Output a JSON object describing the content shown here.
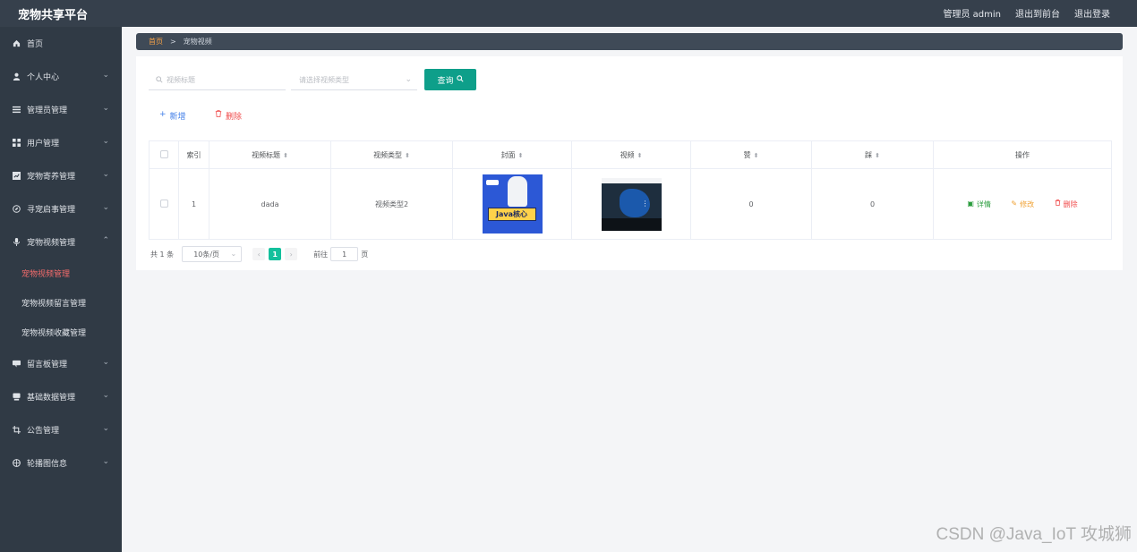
{
  "app": {
    "title": "宠物共享平台"
  },
  "header": {
    "user_label": "管理员 admin",
    "to_front": "退出到前台",
    "logout": "退出登录"
  },
  "sidebar": {
    "items": [
      {
        "label": "首页",
        "icon": "home-icon"
      },
      {
        "label": "个人中心",
        "icon": "user-icon"
      },
      {
        "label": "管理员管理",
        "icon": "menu-icon"
      },
      {
        "label": "用户管理",
        "icon": "grid-icon"
      },
      {
        "label": "宠物寄养管理",
        "icon": "chart-icon"
      },
      {
        "label": "寻宠启事管理",
        "icon": "compass-icon"
      },
      {
        "label": "宠物视频管理",
        "icon": "mic-icon"
      },
      {
        "label": "留言板管理",
        "icon": "comment-icon"
      },
      {
        "label": "基础数据管理",
        "icon": "database-icon"
      },
      {
        "label": "公告管理",
        "icon": "crop-icon"
      },
      {
        "label": "轮播图信息",
        "icon": "globe-icon"
      }
    ],
    "subitems": [
      {
        "label": "宠物视频管理"
      },
      {
        "label": "宠物视频留言管理"
      },
      {
        "label": "宠物视频收藏管理"
      }
    ]
  },
  "breadcrumb": {
    "home": "首页",
    "sep": ">",
    "current": "宠物视频"
  },
  "search": {
    "title_placeholder": "视频标题",
    "type_placeholder": "请选择视频类型",
    "query_label": "查询"
  },
  "actions": {
    "add_label": "新增",
    "delete_label": "删除"
  },
  "table": {
    "columns": [
      "索引",
      "视频标题",
      "视频类型",
      "封面",
      "视频",
      "赞",
      "踩",
      "操作"
    ],
    "rows": [
      {
        "index": "1",
        "title": "dada",
        "type": "视频类型2",
        "cover_text": "Java核心",
        "likes": "0",
        "dislikes": "0"
      }
    ],
    "ops": {
      "detail": "详情",
      "edit": "修改",
      "delete": "删除"
    }
  },
  "pagination": {
    "total": "共 1 条",
    "page_size": "10条/页",
    "current": "1",
    "jump_label": "前往",
    "jump_value": "1",
    "page_suffix": "页"
  },
  "watermark": "CSDN @Java_IoT 攻城狮"
}
